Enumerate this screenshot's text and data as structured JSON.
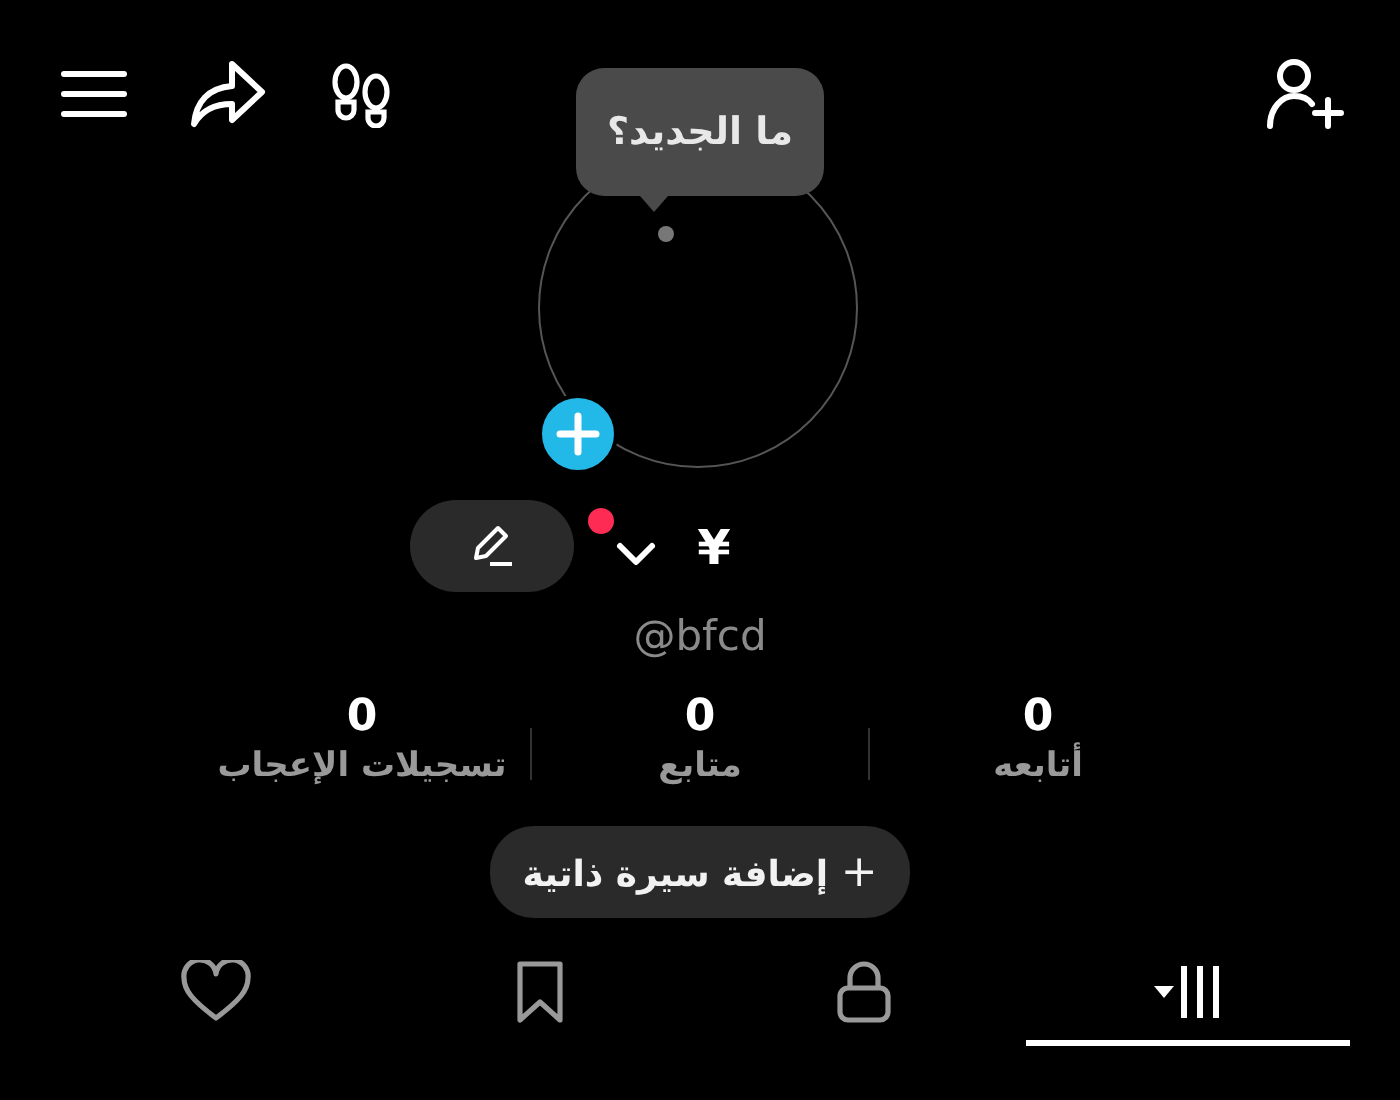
{
  "tooltip": {
    "text": "ما الجديد؟"
  },
  "profile": {
    "currency": "¥",
    "has_notification": true,
    "username": "@bfcd"
  },
  "stats": [
    {
      "value": "0",
      "label": "أتابعه"
    },
    {
      "value": "0",
      "label": "متابع"
    },
    {
      "value": "0",
      "label": "تسجيلات الإعجاب"
    }
  ],
  "bio_button": {
    "icon": "+",
    "label": "إضافة سيرة ذاتية"
  },
  "tabs": [
    {
      "kind": "grid",
      "selected": true
    },
    {
      "kind": "lock",
      "selected": false
    },
    {
      "kind": "bookmark",
      "selected": false
    },
    {
      "kind": "heart",
      "selected": false
    }
  ]
}
